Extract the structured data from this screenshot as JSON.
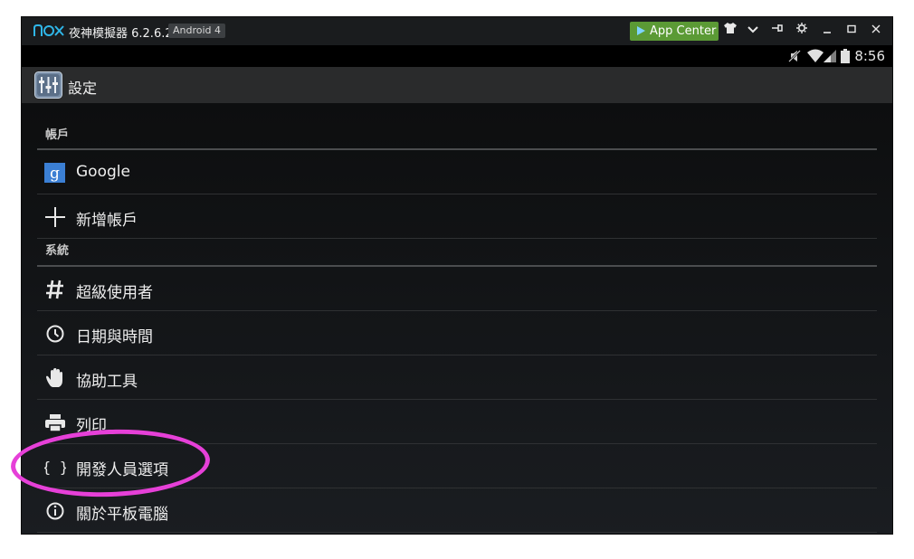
{
  "window": {
    "app_name": "夜神模擬器 6.2.6.2",
    "android_badge": "Android 4",
    "app_center_label": "App Center",
    "toolbar_icons": [
      "shirt-icon",
      "chevron-down-icon",
      "pin-icon",
      "gear-icon",
      "minimize-icon",
      "maximize-icon",
      "close-icon"
    ]
  },
  "statusbar": {
    "time": "8:56",
    "icons": [
      "mute-icon",
      "wifi-icon",
      "signal-icon",
      "battery-icon"
    ]
  },
  "actionbar": {
    "title": "設定"
  },
  "sections": {
    "accounts": {
      "header": "帳戶",
      "items": [
        {
          "label": "Google",
          "icon": "google-icon"
        },
        {
          "label": "新增帳戶",
          "icon": "plus-icon"
        }
      ]
    },
    "system": {
      "header": "系統",
      "items": [
        {
          "label": "超級使用者",
          "icon": "hash-icon"
        },
        {
          "label": "日期與時間",
          "icon": "clock-icon"
        },
        {
          "label": "協助工具",
          "icon": "hand-icon"
        },
        {
          "label": "列印",
          "icon": "printer-icon"
        },
        {
          "label": "開發人員選項",
          "icon": "braces-icon"
        },
        {
          "label": "關於平板電腦",
          "icon": "info-icon"
        }
      ]
    }
  },
  "colors": {
    "accent_green": "#5b9a35",
    "highlight_annotation": "#e640d8",
    "background": "#000000"
  }
}
